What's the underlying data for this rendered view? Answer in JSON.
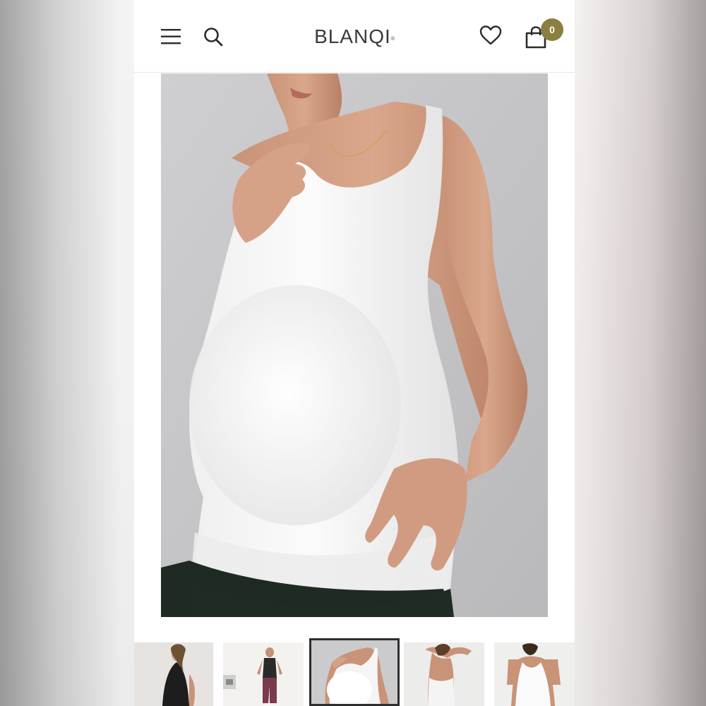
{
  "header": {
    "logo_text": "BLANQI",
    "logo_mark": "®",
    "cart_count": "0",
    "badge_color": "#8a7f3e",
    "icons": [
      "hamburger-menu-icon",
      "search-icon",
      "heart-icon",
      "shopping-bag-icon"
    ]
  },
  "product": {
    "image": "pregnant-model-white-tank",
    "zoom_icon": "magnifier-icon"
  },
  "thumbnails": [
    {
      "name": "model-black-tank-side",
      "selected": false
    },
    {
      "name": "model-black-tank-full",
      "selected": false
    },
    {
      "name": "model-white-tank-front",
      "selected": true
    },
    {
      "name": "model-white-tank-back",
      "selected": false
    },
    {
      "name": "model-white-tank-back-2",
      "selected": false
    }
  ]
}
